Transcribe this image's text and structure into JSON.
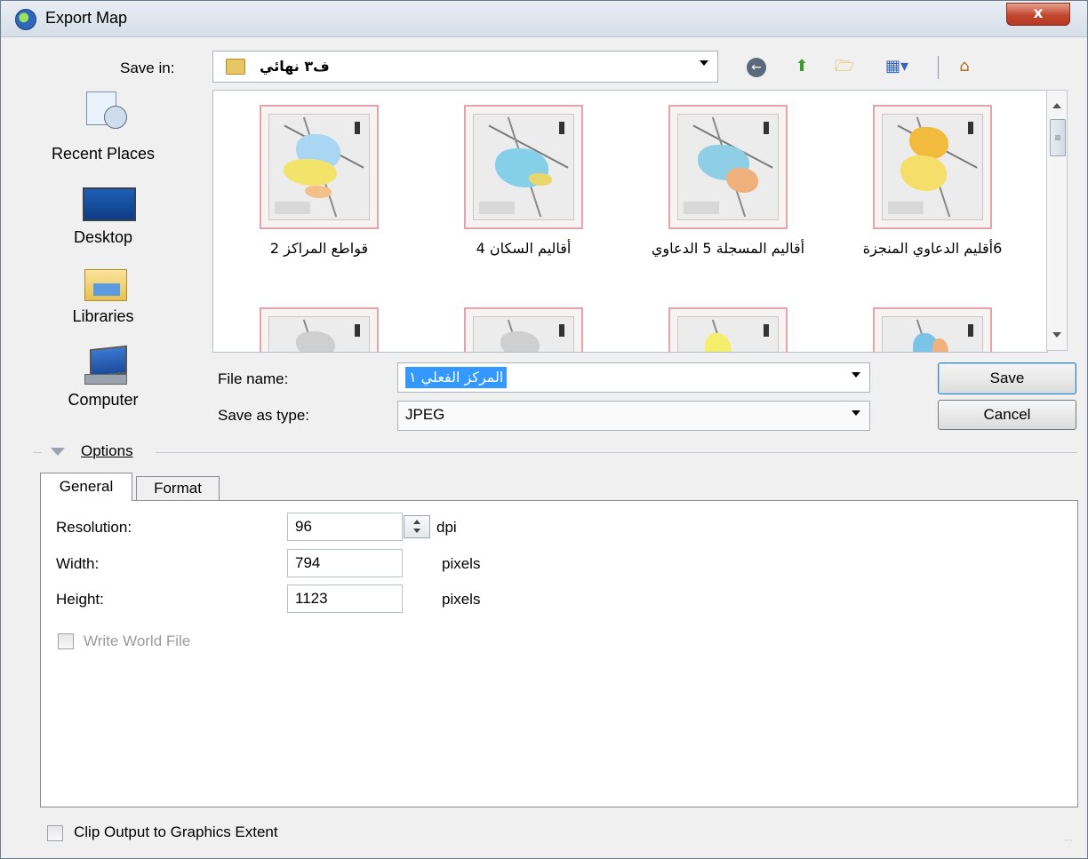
{
  "window": {
    "title": "Export Map",
    "close_label": "x"
  },
  "toolbar": {
    "save_in_label": "Save in:",
    "save_in_value": "ف٣ نهائي",
    "icons": [
      "back-icon",
      "up-folder-icon",
      "new-folder-icon",
      "views-menu-icon",
      "home-icon"
    ]
  },
  "places": [
    {
      "label": "Recent Places",
      "icon": "recent-places-icon"
    },
    {
      "label": "Desktop",
      "icon": "desktop-icon"
    },
    {
      "label": "Libraries",
      "icon": "libraries-icon"
    },
    {
      "label": "Computer",
      "icon": "computer-icon"
    }
  ],
  "files": [
    {
      "name": "قواطع المراكز 2"
    },
    {
      "name": "أقاليم السكان 4"
    },
    {
      "name": "أقاليم المسجلة 5 الدعاوي"
    },
    {
      "name": "6أقليم الدعاوي المنجزة"
    },
    {
      "name": ""
    },
    {
      "name": ""
    },
    {
      "name": ""
    },
    {
      "name": ""
    }
  ],
  "form": {
    "file_name_label": "File name:",
    "file_name_value": "المركز الفعلي ١",
    "type_label": "Save as type:",
    "type_value": "JPEG",
    "save_label": "Save",
    "cancel_label": "Cancel"
  },
  "options": {
    "label": "Options",
    "tabs": [
      "General",
      "Format"
    ],
    "active_tab": "General",
    "resolution_label": "Resolution:",
    "resolution_value": "96",
    "resolution_unit": "dpi",
    "width_label": "Width:",
    "width_value": "794",
    "width_unit": "pixels",
    "height_label": "Height:",
    "height_value": "1123",
    "height_unit": "pixels",
    "world_file_label": "Write World File",
    "world_file_checked": false,
    "world_file_enabled": false
  },
  "footer": {
    "clip_label": "Clip Output to Graphics Extent",
    "clip_checked": false
  }
}
